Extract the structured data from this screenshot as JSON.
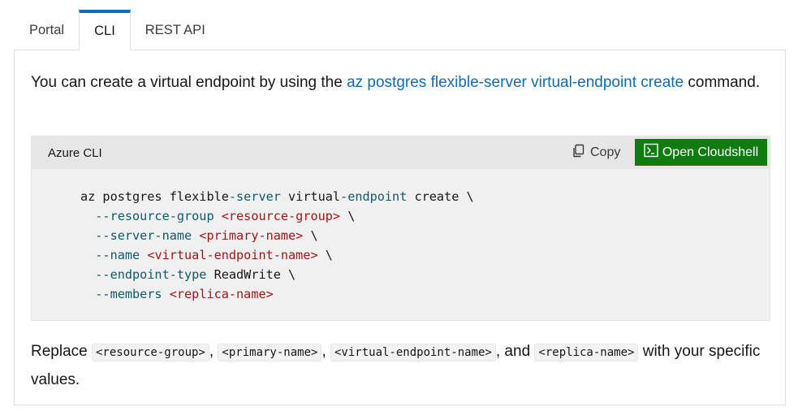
{
  "tabs": [
    {
      "label": "Portal",
      "active": false
    },
    {
      "label": "CLI",
      "active": true
    },
    {
      "label": "REST API",
      "active": false
    }
  ],
  "intro": {
    "text_before": "You can create a virtual endpoint by using the ",
    "link": "az postgres flexible-server virtual-endpoint create",
    "text_after": " command."
  },
  "codeblock": {
    "language": "Azure CLI",
    "copy_label": "Copy",
    "cloudshell_label": "Open Cloudshell",
    "lines": [
      [
        {
          "t": "az postgres flexible",
          "c": ""
        },
        {
          "t": "-server",
          "c": "teal"
        },
        {
          "t": " virtual",
          "c": ""
        },
        {
          "t": "-endpoint",
          "c": "teal"
        },
        {
          "t": " create \\",
          "c": ""
        }
      ],
      [
        {
          "t": "  --resource-group",
          "c": "teal"
        },
        {
          "t": " ",
          "c": ""
        },
        {
          "t": "<resource-group>",
          "c": "red"
        },
        {
          "t": " \\",
          "c": ""
        }
      ],
      [
        {
          "t": "  --server-name",
          "c": "teal"
        },
        {
          "t": " ",
          "c": ""
        },
        {
          "t": "<primary-name>",
          "c": "red"
        },
        {
          "t": " \\",
          "c": ""
        }
      ],
      [
        {
          "t": "  --name",
          "c": "teal"
        },
        {
          "t": " ",
          "c": ""
        },
        {
          "t": "<virtual-endpoint-name>",
          "c": "red"
        },
        {
          "t": " \\",
          "c": ""
        }
      ],
      [
        {
          "t": "  --endpoint-type",
          "c": "teal"
        },
        {
          "t": " ReadWrite \\",
          "c": ""
        }
      ],
      [
        {
          "t": "  --members",
          "c": "teal"
        },
        {
          "t": " ",
          "c": ""
        },
        {
          "t": "<replica-name>",
          "c": "red"
        }
      ]
    ]
  },
  "outro": {
    "prefix": "Replace ",
    "codes": [
      "<resource-group>",
      "<primary-name>",
      "<virtual-endpoint-name>",
      "<replica-name>"
    ],
    "sep1": ", ",
    "sep2": ", ",
    "sep3": ", and ",
    "suffix": " with your specific values."
  },
  "colors": {
    "accent": "#0f6cbd",
    "cloudshell_bg": "#107c10",
    "code_teal": "#0b5a6e",
    "code_red": "#a31515"
  },
  "icons": {
    "copy": "copy-icon",
    "cloudshell": "cloudshell-icon"
  }
}
